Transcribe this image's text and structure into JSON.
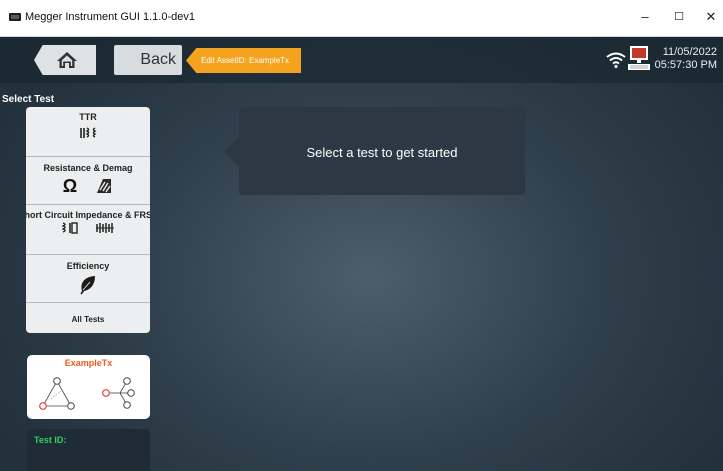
{
  "window": {
    "title": "Megger Instrument GUI 1.1.0-dev1",
    "minimize": "–",
    "maximize": "☐",
    "close": "✕"
  },
  "header": {
    "back_label": "Back",
    "asset_tag": "Edit AssetID: ExampleTx",
    "date": "11/05/2022",
    "time": "05:57:30 PM"
  },
  "sidebar": {
    "select_label": "Select Test",
    "tests": [
      {
        "label": "TTR",
        "icons": [
          "ttr-transformer-icon"
        ]
      },
      {
        "label": "Resistance & Demag",
        "icons": [
          "omega-icon",
          "demag-icon"
        ]
      },
      {
        "label": "Short Circuit Impedance & FRSL",
        "icons": [
          "short-circuit-icon",
          "frsl-coil-icon"
        ]
      },
      {
        "label": "Efficiency",
        "icons": [
          "leaf-icon"
        ]
      },
      {
        "label": "All Tests",
        "icons": []
      }
    ],
    "omega_symbol": "Ω",
    "asset_name": "ExampleTx",
    "test_id_label": "Test ID:"
  },
  "main": {
    "prompt": "Select a test to get started"
  },
  "colors": {
    "accent_orange": "#f5a31f",
    "asset_name": "#ef5a24",
    "test_id_green": "#2ed05a",
    "background": "#2f3f4b"
  }
}
